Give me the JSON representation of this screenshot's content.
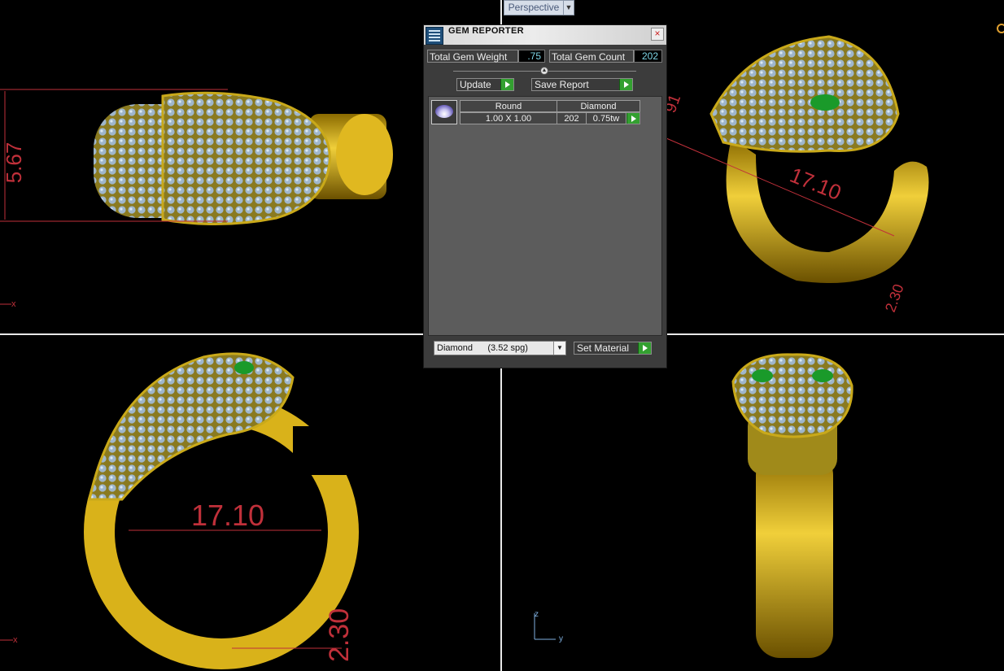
{
  "viewport": {
    "mode_label": "Perspective",
    "axis_z": "z",
    "axis_y": "y",
    "corner_marker": "x"
  },
  "dimensions": {
    "top_left_side": "5.67",
    "top_right_a": "91",
    "top_right_b": "17.10",
    "top_right_c": "2.30",
    "bottom_left_inner": "17.10",
    "bottom_left_width": "2.30"
  },
  "gem_reporter": {
    "title": "GEM REPORTER",
    "close_icon": "×",
    "total_weight_label": "Total Gem Weight",
    "total_weight_value": ".75",
    "total_count_label": "Total Gem Count",
    "total_count_value": "202",
    "update_label": "Update",
    "save_report_label": "Save Report",
    "gem_rows": [
      {
        "shape": "Round",
        "material": "Diamond",
        "size": "1.00 X 1.00",
        "count": "202",
        "weight": "0.75tw"
      }
    ],
    "material_select": "Diamond      (3.52 spg)",
    "set_material_label": "Set Material"
  },
  "colors": {
    "gold": "#d9b21a",
    "dimension_red": "#c0303a",
    "accent_green": "#33a030"
  }
}
